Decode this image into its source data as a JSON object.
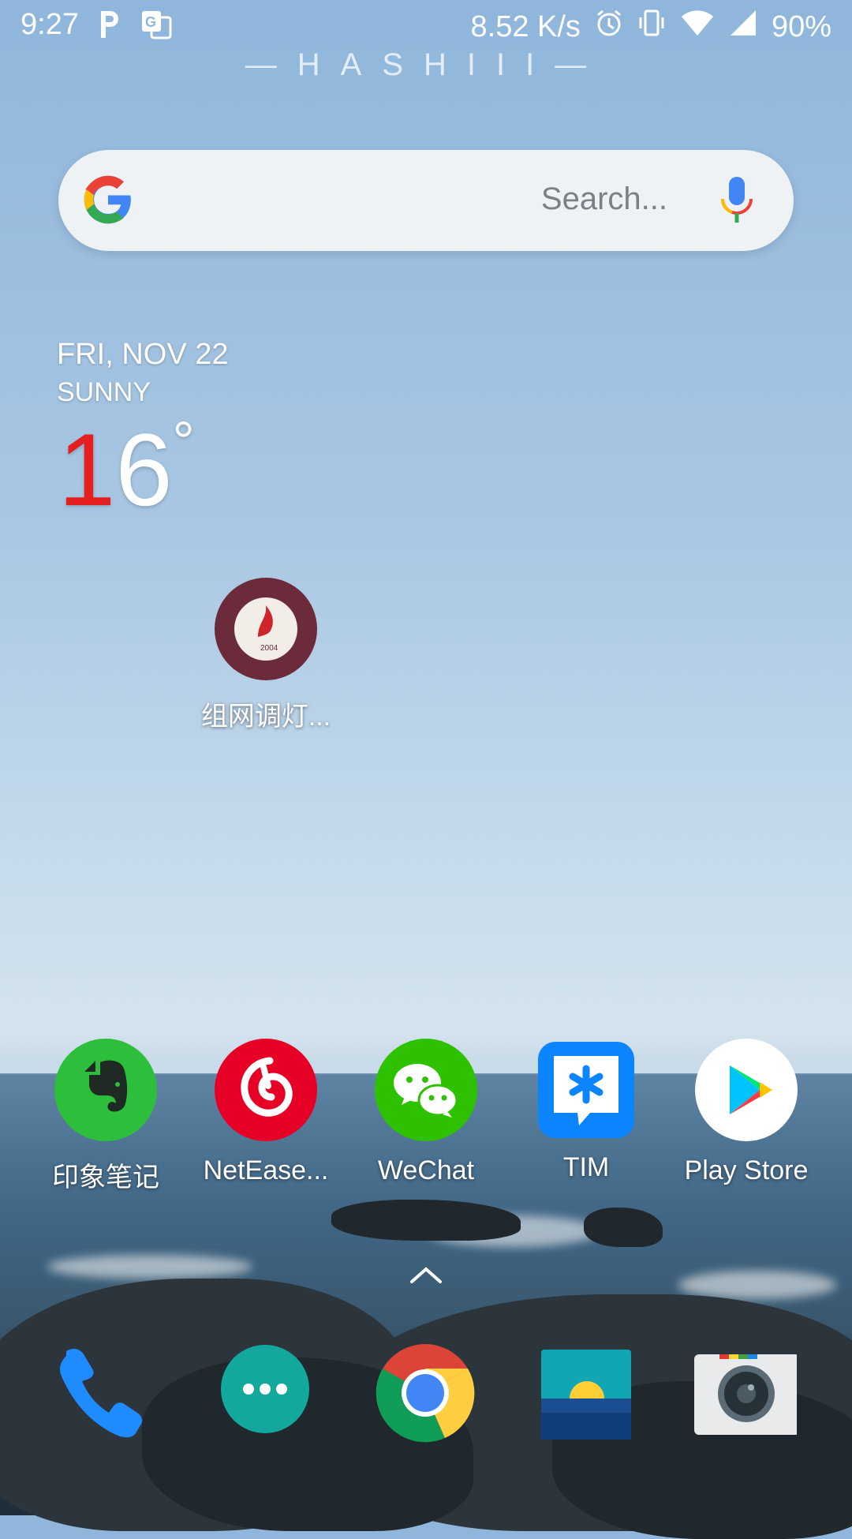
{
  "status_bar": {
    "time": "9:27",
    "network_speed": "8.52 K/s",
    "battery": "90%",
    "icons": [
      "p-icon",
      "translate-icon",
      "alarm-icon",
      "vibrate-icon",
      "wifi-icon",
      "signal-icon"
    ]
  },
  "brand": "—HASHIII—",
  "search": {
    "placeholder": "Search..."
  },
  "weather": {
    "date": "FRI, NOV 22",
    "condition": "SUNNY",
    "temp_digit_1": "1",
    "temp_digit_2": "6",
    "degree": "°"
  },
  "desktop_app": {
    "label": "组网调灯...",
    "icon": "school-seal-icon"
  },
  "apps": [
    {
      "label": "印象笔记",
      "icon": "evernote-icon",
      "color": "#2dbe3c"
    },
    {
      "label": "NetEase...",
      "icon": "netease-music-icon",
      "color": "#e60026"
    },
    {
      "label": "WeChat",
      "icon": "wechat-icon",
      "color": "#2dc100"
    },
    {
      "label": "TIM",
      "icon": "tim-icon",
      "color": "#0a84ff"
    },
    {
      "label": "Play Store",
      "icon": "play-store-icon",
      "color": "#ffffff"
    }
  ],
  "dock": [
    {
      "icon": "phone-icon"
    },
    {
      "icon": "messages-icon"
    },
    {
      "icon": "chrome-icon"
    },
    {
      "icon": "gallery-icon"
    },
    {
      "icon": "camera-icon"
    }
  ]
}
